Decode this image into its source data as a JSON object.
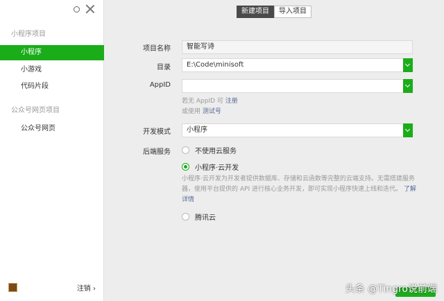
{
  "sidebar": {
    "section_miniprogram": "小程序项目",
    "items": [
      {
        "label": "小程序"
      },
      {
        "label": "小游戏"
      },
      {
        "label": "代码片段"
      }
    ],
    "section_web": "公众号网页项目",
    "web_item": "公众号网页",
    "logout": "注销 ›"
  },
  "tabs": [
    {
      "label": "新建项目"
    },
    {
      "label": "导入项目"
    }
  ],
  "form": {
    "name_label": "项目名称",
    "name_value": "智能写诗",
    "dir_label": "目录",
    "dir_value": "E:\\Code\\minisoft",
    "appid_label": "AppID",
    "appid_value": "",
    "appid_hint_prefix": "若无 AppID 可",
    "appid_hint_register": "注册",
    "appid_hint2_prefix": "或使用",
    "appid_hint2_link": "测试号",
    "mode_label": "开发模式",
    "mode_value": "小程序",
    "backend_label": "后端服务",
    "backend_options": [
      {
        "label": "不使用云服务",
        "checked": false
      },
      {
        "label": "小程序·云开发",
        "checked": true
      },
      {
        "label": "腾讯云",
        "checked": false
      }
    ],
    "cloud_desc": "小程序·云开发为开发者提供数据库、存储和云函数等完整的云端支持。无需搭建服务器，使用平台提供的 API 进行核心业务开发，即可实现小程序快速上线和迭代。",
    "cloud_learn_more": "了解详情"
  },
  "watermark": "头条 @Tingro说前端",
  "colors": {
    "accent": "#1aad19",
    "link": "#576b95"
  }
}
